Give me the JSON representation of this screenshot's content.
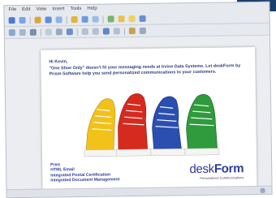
{
  "menu": [
    "File",
    "Edit",
    "View",
    "Insert",
    "Tools",
    "Help"
  ],
  "document": {
    "greeting": "Hi Kevin,",
    "body": "\"One Shoe Only\" doesn't fit your messaging needs at Irvine Data Systems. Let deskForm by Prism Software help you send personalized communications to your customers.",
    "products": [
      "Print",
      "HTML Email",
      "Integrated Postal Certification",
      "Integrated Document Management"
    ],
    "brand_light": "desk",
    "brand_bold": "Form",
    "tagline": "Personalized Communications"
  },
  "colors": {
    "corner_block": "#1b3f6b",
    "text_blue": "#2c3e78",
    "brand_blue": "#2e3a96",
    "shoe_yellow": "#f2c21a",
    "shoe_red": "#d62a1f",
    "shoe_blue": "#2a4fb0",
    "shoe_green": "#2f9b3c"
  }
}
